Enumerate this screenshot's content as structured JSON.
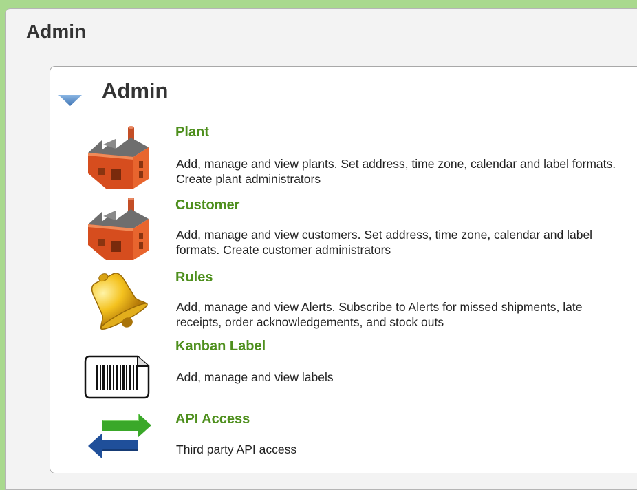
{
  "outer_title": "Admin",
  "panel_title": "Admin",
  "colors": {
    "page_background": "#a9d98e",
    "link_green": "#4e8f1d",
    "toggle_blue": "#5b8fc7"
  },
  "items": [
    {
      "title": "Plant",
      "description": "Add, manage and view plants. Set address, time zone, calendar and label formats. Create plant administrators",
      "icon": "factory-icon"
    },
    {
      "title": "Customer",
      "description": "Add, manage and view customers. Set address, time zone, calendar and label formats. Create customer administrators",
      "icon": "factory-icon"
    },
    {
      "title": "Rules",
      "description": "Add, manage and view Alerts. Subscribe to Alerts for missed shipments, late receipts, order acknowledgements, and stock outs",
      "icon": "bell-icon"
    },
    {
      "title": "Kanban Label",
      "description": "Add, manage and view labels",
      "icon": "barcode-label-icon"
    },
    {
      "title": "API Access",
      "description": "Third party API access",
      "icon": "exchange-arrows-icon"
    }
  ]
}
